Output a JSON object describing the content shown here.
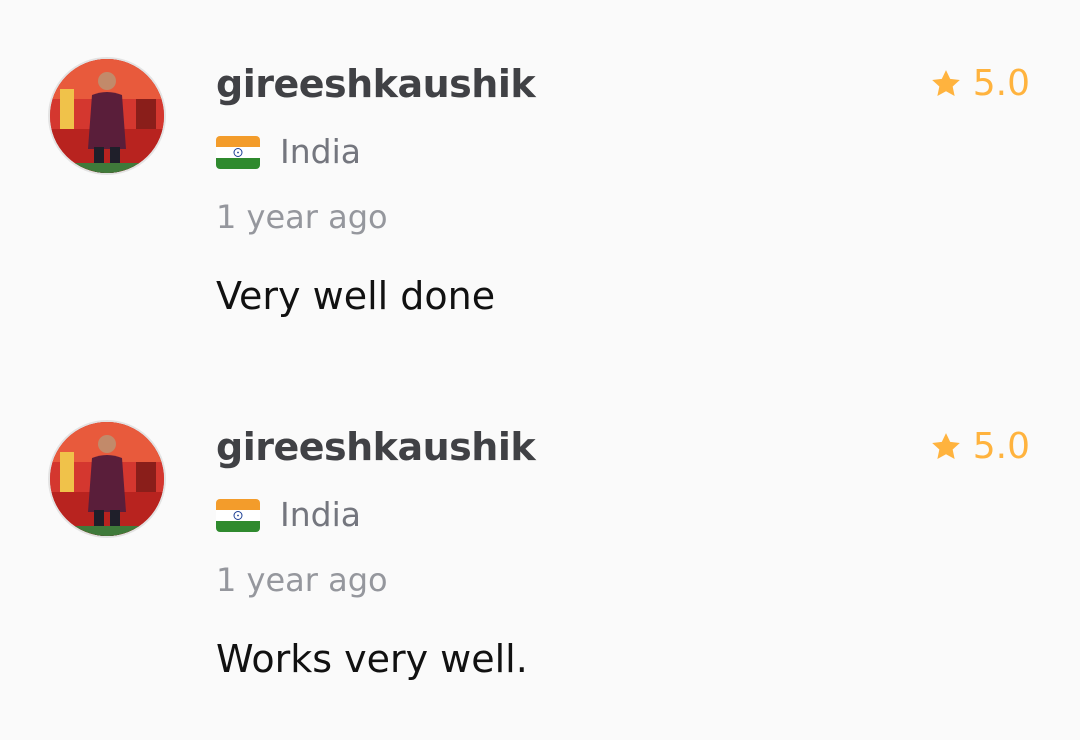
{
  "reviews": [
    {
      "username": "gireeshkaushik",
      "rating": "5.0",
      "country": "India",
      "country_flag": "india-flag-icon",
      "time": "1 year ago",
      "comment": "Very well done"
    },
    {
      "username": "gireeshkaushik",
      "rating": "5.0",
      "country": "India",
      "country_flag": "india-flag-icon",
      "time": "1 year ago",
      "comment": "Works very well."
    }
  ],
  "colors": {
    "star": "#ffb33e",
    "username": "#404145",
    "muted": "#74767e",
    "background": "#fafafa"
  }
}
